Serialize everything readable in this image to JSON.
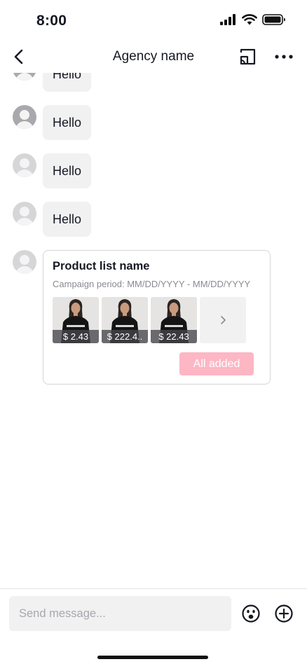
{
  "status_bar": {
    "time": "8:00",
    "icons": [
      "signal-icon",
      "wifi-icon",
      "battery-icon"
    ]
  },
  "header": {
    "back_icon": "chevron-left-icon",
    "title": "Agency name",
    "cast_icon": "cast-icon",
    "more_icon": "more-icon"
  },
  "messages": [
    {
      "type": "text",
      "text": "Hello"
    },
    {
      "type": "text",
      "text": "Hello"
    },
    {
      "type": "text",
      "text": "Hello"
    },
    {
      "type": "text",
      "text": "Hello"
    }
  ],
  "product_card": {
    "title": "Product list name",
    "period": "Campaign period: MM/DD/YYYY - MM/DD/YYYY",
    "products": [
      {
        "price": "$ 2.43"
      },
      {
        "price": "$ 222.4.."
      },
      {
        "price": "$ 22.43"
      }
    ],
    "more_icon": "chevron-right-icon",
    "button_label": "All added"
  },
  "composer": {
    "placeholder": "Send message...",
    "emoji_icon": "emoji-icon",
    "add_icon": "plus-circle-icon"
  },
  "colors": {
    "bubble_bg": "#f1f1f2",
    "button_disabled": "#fdb6c4",
    "text": "#161823",
    "muted": "#8a8b91"
  }
}
